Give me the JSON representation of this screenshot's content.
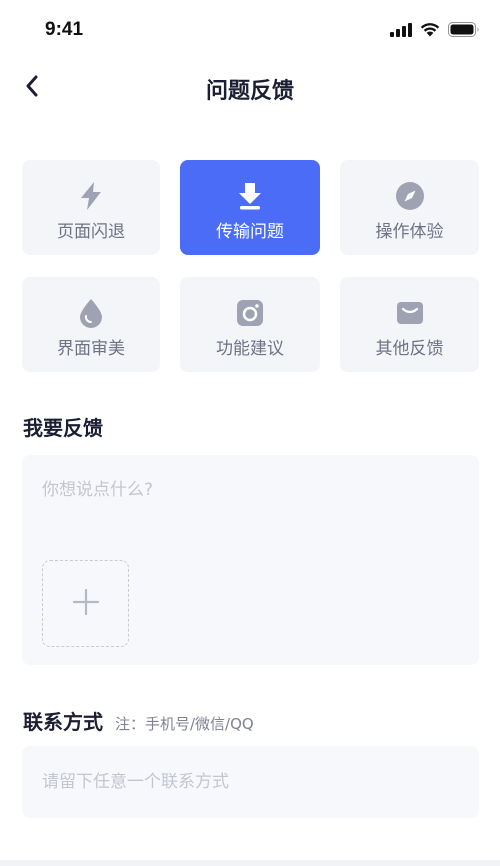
{
  "status_bar": {
    "time": "9:41",
    "icons": [
      "cellular-signal-icon",
      "wifi-icon",
      "battery-icon"
    ]
  },
  "nav": {
    "back_icon": "chevron-left-icon",
    "title": "问题反馈"
  },
  "categories": [
    {
      "label": "页面闪退",
      "icon": "lightning-icon",
      "selected": false
    },
    {
      "label": "传输问题",
      "icon": "download-arrow-icon",
      "selected": true
    },
    {
      "label": "操作体验",
      "icon": "compass-icon",
      "selected": false
    },
    {
      "label": "界面审美",
      "icon": "droplet-icon",
      "selected": false
    },
    {
      "label": "功能建议",
      "icon": "camera-icon",
      "selected": false
    },
    {
      "label": "其他反馈",
      "icon": "mail-icon",
      "selected": false
    }
  ],
  "feedback": {
    "title": "我要反馈",
    "placeholder": "你想说点什么?",
    "value": "",
    "upload_icon": "plus-icon"
  },
  "contact": {
    "title": "联系方式",
    "note": "注：手机号/微信/QQ",
    "placeholder": "请留下任意一个联系方式",
    "value": ""
  },
  "colors": {
    "accent": "#4a6cf7",
    "card_bg": "#f4f5f8",
    "icon_gray": "#9ea2b3",
    "text_dark": "#1c1f33",
    "text_muted": "#6e7285",
    "placeholder": "#c4c6cf"
  }
}
